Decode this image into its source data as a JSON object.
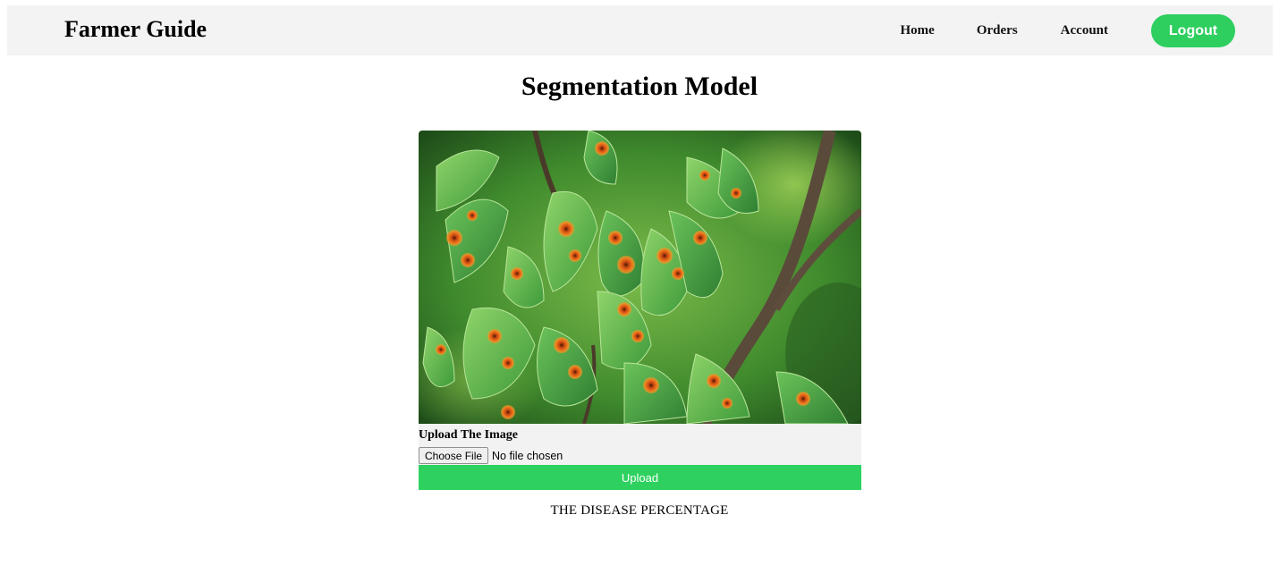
{
  "header": {
    "brand": "Farmer Guide",
    "nav": {
      "home": "Home",
      "orders": "Orders",
      "account": "Account",
      "logout": "Logout"
    }
  },
  "main": {
    "title": "Segmentation Model",
    "image": {
      "icon": "diseased-leaves-photo"
    },
    "upload": {
      "label": "Upload The Image",
      "choose_button": "Choose File",
      "file_status": "No file chosen",
      "submit": "Upload"
    },
    "result_label": "THE DISEASE PERCENTAGE"
  },
  "colors": {
    "accent": "#2ecf5f",
    "nav_bg": "#f3f3f3"
  }
}
